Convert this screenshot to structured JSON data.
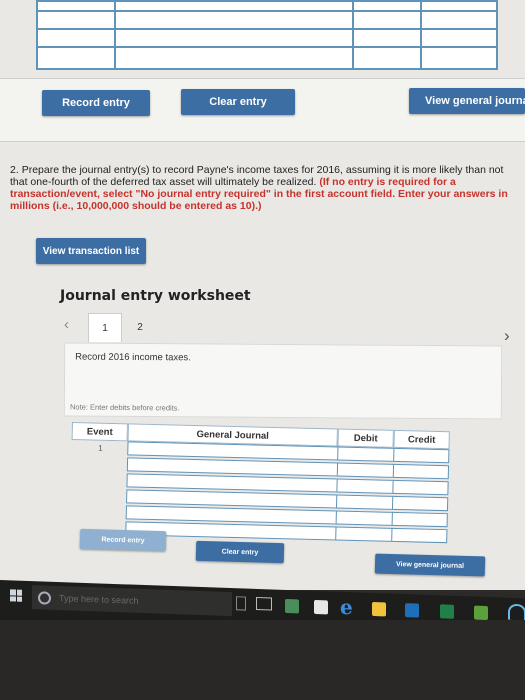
{
  "top_buttons": {
    "record": "Record entry",
    "clear": "Clear entry",
    "view": "View general journa"
  },
  "question": {
    "number": "2.",
    "text": "Prepare the journal entry(s) to record Payne's income taxes for 2016, assuming it is more likely than not that one-fourth of the deferred tax asset will ultimately be realized.",
    "instruction": "(If no entry is required for a transaction/event, select \"No journal entry required\" in the first account field. Enter your answers in millions (i.e., 10,000,000 should be entered as 10).)"
  },
  "view_transactions": "View transaction list",
  "worksheet": {
    "title": "Journal entry worksheet",
    "tabs": [
      "1",
      "2"
    ],
    "description": "Record 2016 income taxes.",
    "note": "Note: Enter debits before credits.",
    "headers": {
      "event": "Event",
      "journal": "General Journal",
      "debit": "Debit",
      "credit": "Credit"
    },
    "first_event": "1",
    "buttons": {
      "record": "Record entry",
      "clear": "Clear entry",
      "view": "View general journal"
    }
  },
  "taskbar": {
    "search_placeholder": "Type here to search"
  },
  "colors": {
    "primary_button": "#3d6ea3",
    "faded_button": "#8fb0d0",
    "cell_border": "#5f93b8",
    "instruction_red": "#c8322c"
  }
}
